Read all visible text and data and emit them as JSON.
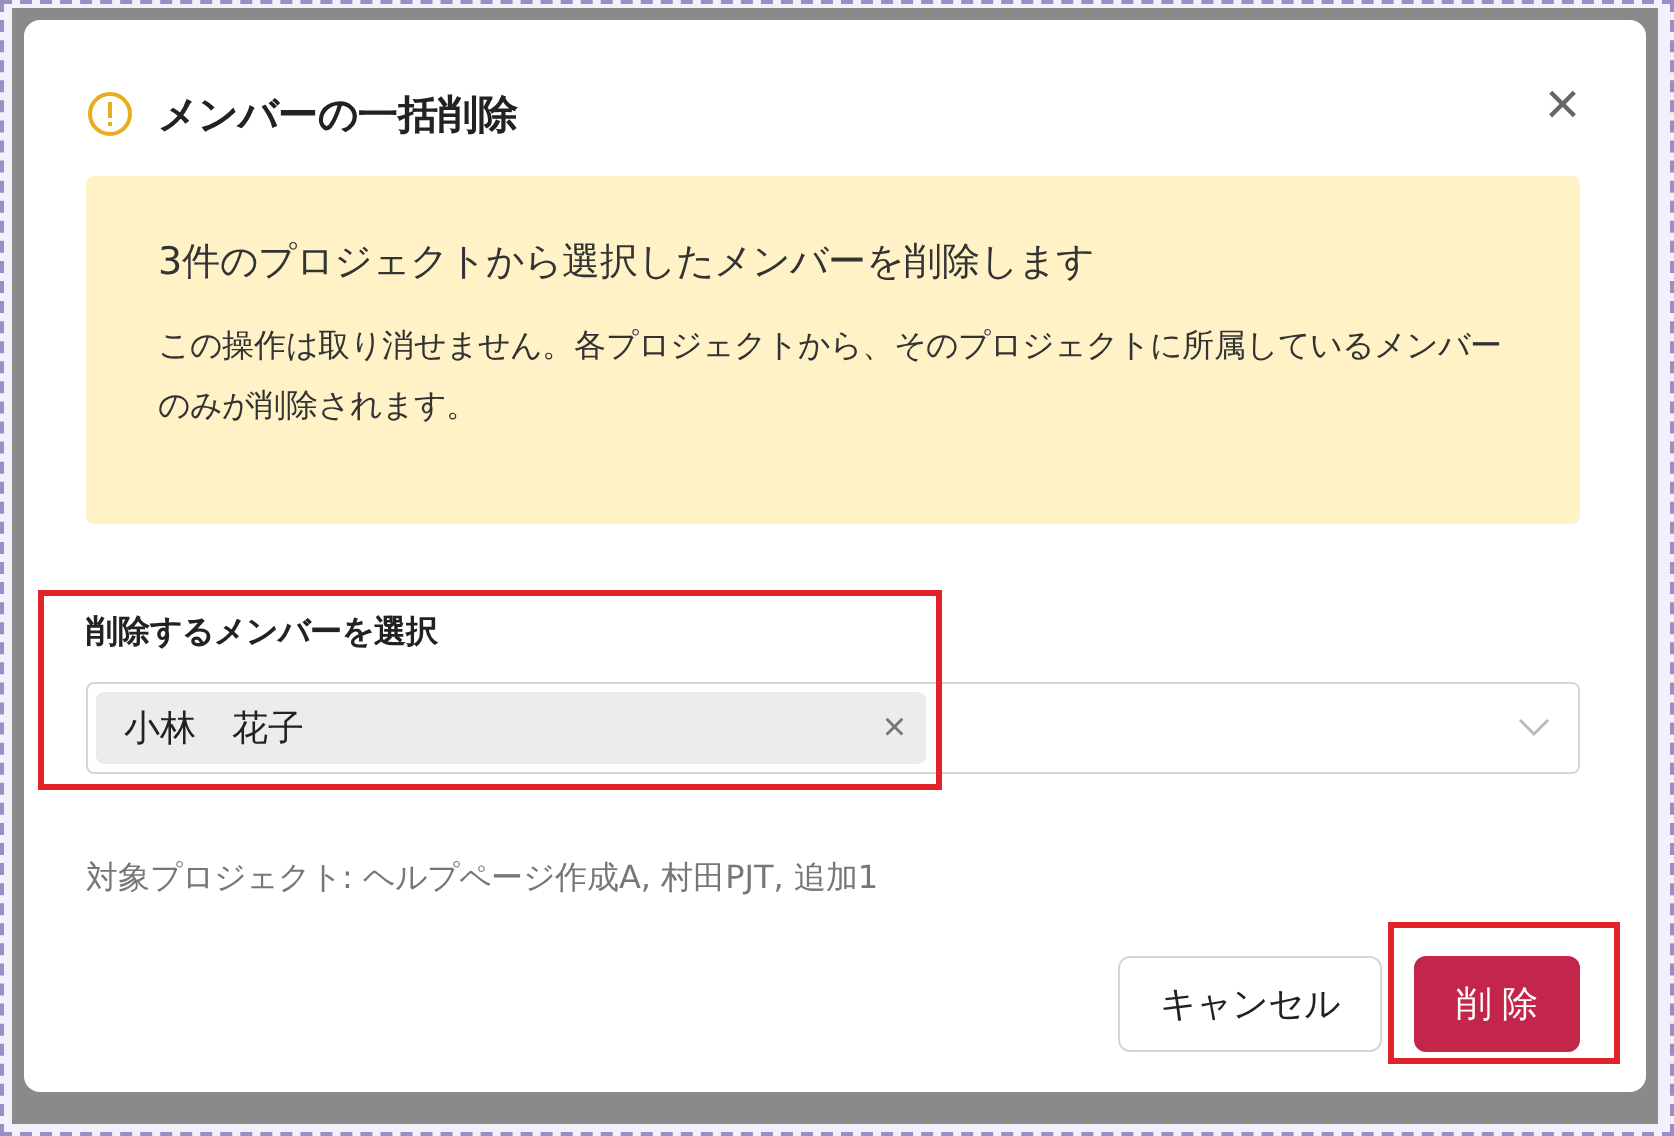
{
  "dialog": {
    "title": "メンバーの一括削除",
    "close_label": "×"
  },
  "alert": {
    "heading": "3件のプロジェクトから選択したメンバーを削除します",
    "body": "この操作は取り消せません。各プロジェクトから、そのプロジェクトに所属しているメンバーのみが削除されます。"
  },
  "member_select": {
    "label": "削除するメンバーを選択",
    "tags": [
      {
        "label": "小林　花子",
        "remove": "×"
      }
    ]
  },
  "target_projects": "対象プロジェクト: ヘルプページ作成A, 村田PJT, 追加1",
  "buttons": [
    {
      "label": "キャンセル",
      "kind": "secondary"
    },
    {
      "label": "削 除",
      "kind": "danger"
    }
  ]
}
